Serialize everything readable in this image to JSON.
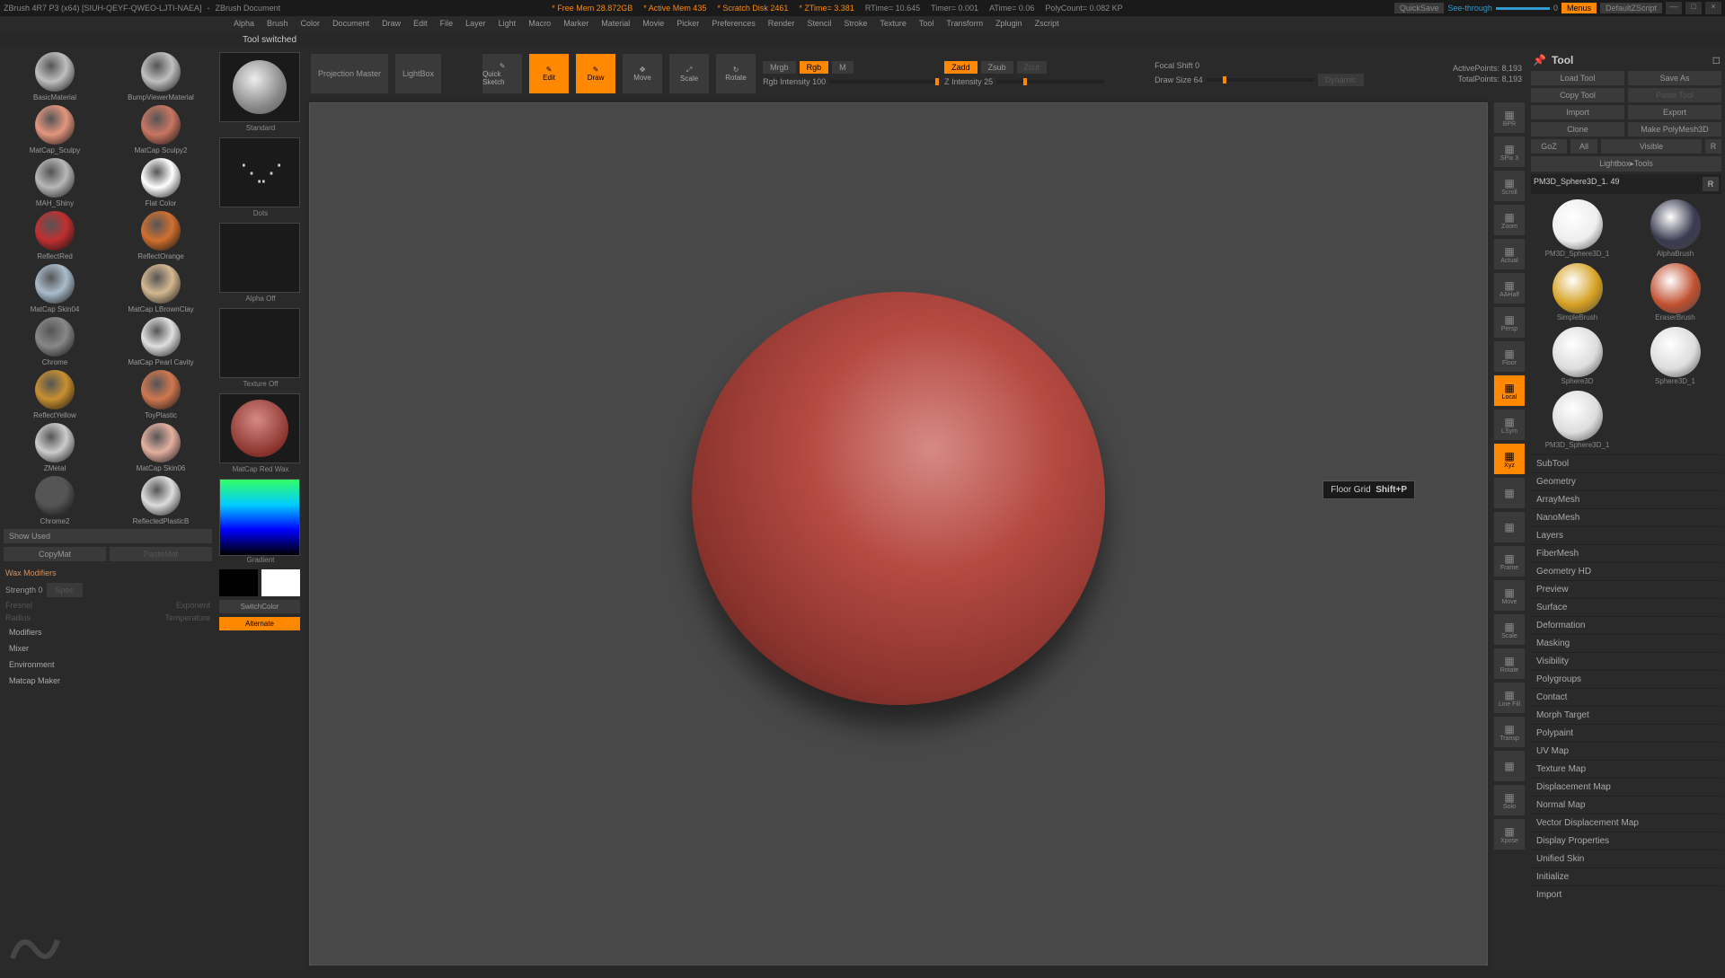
{
  "titlebar": {
    "app": "ZBrush 4R7 P3 (x64) [SIUH-QEYF-QWEO-LJTI-NAEA]",
    "doc": "ZBrush Document",
    "free_mem": "* Free Mem 28.872GB",
    "active_mem": "* Active Mem 435",
    "scratch": "* Scratch Disk 2461",
    "ztime": "* ZTime= 3.381",
    "rtime": "RTime= 10.645",
    "timer": "Timer= 0.001",
    "atime": "ATime= 0.06",
    "poly": "PolyCount= 0.082 KP",
    "quicksave": "QuickSave",
    "seethrough": "See-through",
    "seevalue": "0",
    "menus": "Menus",
    "config": "DefaultZScript"
  },
  "menus": [
    "Alpha",
    "Brush",
    "Color",
    "Document",
    "Draw",
    "Edit",
    "File",
    "Layer",
    "Light",
    "Macro",
    "Marker",
    "Material",
    "Movie",
    "Picker",
    "Preferences",
    "Render",
    "Stencil",
    "Stroke",
    "Texture",
    "Tool",
    "Transform",
    "Zplugin",
    "Zscript"
  ],
  "status": "Tool switched",
  "materials": [
    {
      "name": "BasicMaterial",
      "color": "#bfbfc0"
    },
    {
      "name": "BumpViewerMaterial",
      "color": "#bfbfc0"
    },
    {
      "name": "MatCap_Sculpy",
      "color": "#e3967e"
    },
    {
      "name": "MatCap Sculpy2",
      "color": "#c97662"
    },
    {
      "name": "MAH_Shiny",
      "color": "#b8b8b8"
    },
    {
      "name": "Flat Color",
      "color": "#ffffff"
    },
    {
      "name": "ReflectRed",
      "color": "#c03030"
    },
    {
      "name": "ReflectOrange",
      "color": "#d07030"
    },
    {
      "name": "MatCap Skin04",
      "color": "#aabccc"
    },
    {
      "name": "MatCap LBrownClay",
      "color": "#d4b890"
    },
    {
      "name": "Chrome",
      "color": "#888"
    },
    {
      "name": "MatCap Pearl Cavity",
      "color": "#e0e0e0"
    },
    {
      "name": "ReflectYellow",
      "color": "#c89030"
    },
    {
      "name": "ToyPlastic",
      "color": "#d07850"
    },
    {
      "name": "ZMetal",
      "color": "#ccc"
    },
    {
      "name": "MatCap Skin06",
      "color": "#e4b0a0"
    },
    {
      "name": "Chrome2",
      "color": "#555"
    },
    {
      "name": "ReflectedPlasticB",
      "color": "#ddd"
    }
  ],
  "left_buttons": {
    "show_used": "Show Used",
    "copy": "CopyMat",
    "paste": "PasteMat"
  },
  "wax": {
    "title": "Wax Modifiers",
    "strength": "Strength 0",
    "fresnel": "Fresnel",
    "exponent": "Exponent",
    "radius": "Radius",
    "temperature": "Temperature",
    "spec": "Spec"
  },
  "left_subs": [
    "Modifiers",
    "Mixer",
    "Environment",
    "Matcap Maker"
  ],
  "col2": {
    "standard": "Standard",
    "dots": "Dots",
    "alpha_off": "Alpha Off",
    "texture_off": "Texture Off",
    "current": "MatCap Red Wax",
    "gradient": "Gradient",
    "switch": "SwitchColor",
    "alternate": "Alternate"
  },
  "toolbar": {
    "projection": "Projection Master",
    "lightbox": "LightBox",
    "quicksketch": "Quick Sketch",
    "edit": "Edit",
    "draw": "Draw",
    "move": "Move",
    "scale": "Scale",
    "rotate": "Rotate",
    "mrgb": "Mrgb",
    "rgb": "Rgb",
    "m": "M",
    "rgb_intensity": "Rgb Intensity 100",
    "zadd": "Zadd",
    "zsub": "Zsub",
    "zcut": "Zcut",
    "z_intensity": "Z Intensity 25",
    "focal": "Focal Shift 0",
    "draw_size": "Draw Size 64",
    "dynamic": "Dynamic",
    "active_pts": "ActivePoints: 8,193",
    "total_pts": "TotalPoints: 8,193"
  },
  "tooltip": {
    "text": "Floor Grid",
    "shortcut": "Shift+P"
  },
  "rail": [
    {
      "name": "bpr",
      "label": "BPR",
      "on": false
    },
    {
      "name": "spix",
      "label": "SPix 3",
      "on": false
    },
    {
      "name": "scroll",
      "label": "Scroll",
      "on": false
    },
    {
      "name": "zoom",
      "label": "Zoom",
      "on": false
    },
    {
      "name": "actual",
      "label": "Actual",
      "on": false
    },
    {
      "name": "aathalf",
      "label": "AAHalf",
      "on": false
    },
    {
      "name": "persp",
      "label": "Persp",
      "on": false
    },
    {
      "name": "floor",
      "label": "Floor",
      "on": false
    },
    {
      "name": "local",
      "label": "Local",
      "on": true
    },
    {
      "name": "lsym",
      "label": "LSym",
      "on": false
    },
    {
      "name": "xyz",
      "label": "Xyz",
      "on": true
    },
    {
      "name": "center",
      "label": "",
      "on": false
    },
    {
      "name": "polyf",
      "label": "",
      "on": false
    },
    {
      "name": "frame",
      "label": "Frame",
      "on": false
    },
    {
      "name": "move",
      "label": "Move",
      "on": false
    },
    {
      "name": "scale",
      "label": "Scale",
      "on": false
    },
    {
      "name": "rotate",
      "label": "Rotate",
      "on": false
    },
    {
      "name": "linefill",
      "label": "Line Fill",
      "on": false
    },
    {
      "name": "transp",
      "label": "Transp",
      "on": false
    },
    {
      "name": "ghost",
      "label": "",
      "on": false
    },
    {
      "name": "solo",
      "label": "Solo",
      "on": false
    },
    {
      "name": "xpose",
      "label": "Xpose",
      "on": false
    }
  ],
  "right": {
    "title": "Tool",
    "load": "Load Tool",
    "save": "Save As",
    "copy": "Copy Tool",
    "paste": "Paste Tool",
    "import": "Import",
    "export": "Export",
    "clone": "Clone",
    "make": "Make PolyMesh3D",
    "goz": "GoZ",
    "all": "All",
    "visible": "Visible",
    "r": "R",
    "lightbox": "Lightbox▸Tools",
    "toolname": "PM3D_Sphere3D_1. 49",
    "r2": "R",
    "tools": [
      {
        "name": "PM3D_Sphere3D_1",
        "color": "#eee"
      },
      {
        "name": "AlphaBrush",
        "color": "#3a3a50"
      },
      {
        "name": "SimpleBrush",
        "color": "#d4a020"
      },
      {
        "name": "EraserBrush",
        "color": "#c05030"
      },
      {
        "name": "Sphere3D",
        "color": "#ddd"
      },
      {
        "name": "Sphere3D_1",
        "color": "#ddd"
      },
      {
        "name": "PM3D_Sphere3D_1",
        "color": "#ddd"
      }
    ],
    "sections": [
      "SubTool",
      "Geometry",
      "ArrayMesh",
      "NanoMesh",
      "Layers",
      "FiberMesh",
      "Geometry HD",
      "Preview",
      "Surface",
      "Deformation",
      "Masking",
      "Visibility",
      "Polygroups",
      "Contact",
      "Morph Target",
      "Polypaint",
      "UV Map",
      "Texture Map",
      "Displacement Map",
      "Normal Map",
      "Vector Displacement Map",
      "Display Properties",
      "Unified Skin",
      "Initialize",
      "Import"
    ]
  }
}
